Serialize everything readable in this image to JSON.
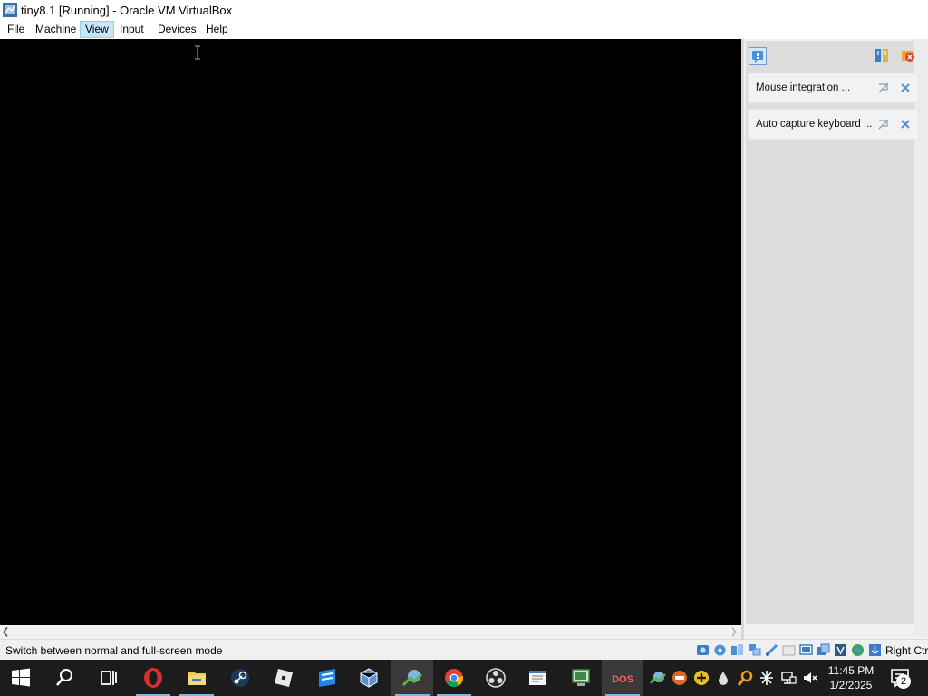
{
  "window": {
    "title": "tiny8.1 [Running] - Oracle VM VirtualBox"
  },
  "menu": {
    "items": [
      {
        "label": "File"
      },
      {
        "label": "Machine"
      },
      {
        "label": "View",
        "active": true
      },
      {
        "label": "Input"
      },
      {
        "label": "Devices"
      },
      {
        "label": "Help"
      }
    ]
  },
  "notifications": {
    "items": [
      {
        "text": "Mouse integration ...",
        "icons": [
          "mouse-integration-icon",
          "close-icon"
        ]
      },
      {
        "text": "Auto capture keyboard ...",
        "icons": [
          "keyboard-icon",
          "close-icon"
        ]
      }
    ],
    "header_icons": [
      "notification-center-icon",
      "toggle-all-icon",
      "close-all-icon"
    ]
  },
  "status_bar": {
    "text": "Switch between normal and full-screen mode",
    "host_key": "Right Ctrl",
    "indicator_icons": [
      "hard-disk-icon",
      "optical-drive-icon",
      "audio-icon",
      "network-icon",
      "usb-icon",
      "shared-folders-icon",
      "display-icon",
      "recording-icon",
      "vrde-icon",
      "features-icon",
      "mouse-integration-icon",
      "keyboard-capture-icon"
    ]
  },
  "taskbar": {
    "apps": [
      "start-icon",
      "search-icon",
      "task-view-icon",
      "opera-icon",
      "file-explorer-icon",
      "steam-icon",
      "roblox-icon",
      "roblox-studio-icon",
      "virtualbox-icon",
      "mapper-icon",
      "chrome-icon",
      "obs-icon",
      "notepad-icon",
      "vm-manager-icon",
      "dosbox-icon"
    ],
    "tray_icons": [
      "tray-app1-icon",
      "tray-app2-icon",
      "tray-app3-icon",
      "tray-app4-icon",
      "tray-app5-icon",
      "tray-app6-icon",
      "network-icon",
      "volume-muted-icon"
    ],
    "clock": {
      "time": "11:45 PM",
      "date": "1/2/2025"
    },
    "notification_count": "2"
  },
  "colors": {
    "vm_background": "#000000",
    "taskbar": "#1c1c1c",
    "menu_active": "#cce4f7",
    "accent": "#76b9ed"
  }
}
